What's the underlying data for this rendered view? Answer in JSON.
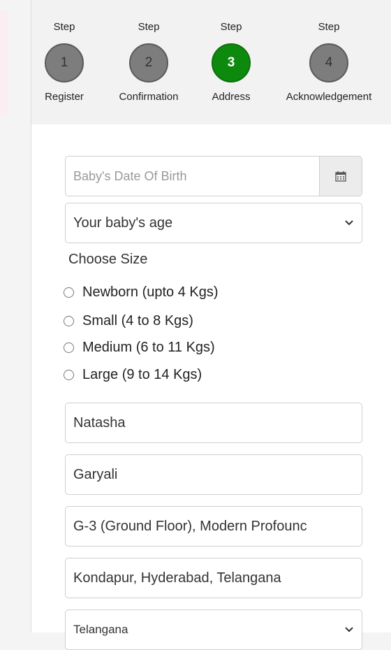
{
  "stepper": {
    "steps": [
      {
        "prefix": "Step",
        "number": "1",
        "label": "Register",
        "active": false
      },
      {
        "prefix": "Step",
        "number": "2",
        "label": "Confirmation",
        "active": false
      },
      {
        "prefix": "Step",
        "number": "3",
        "label": "Address",
        "active": true
      },
      {
        "prefix": "Step",
        "number": "4",
        "label": "Acknowledgement",
        "active": false
      }
    ]
  },
  "form": {
    "dob_placeholder": "Baby's Date Of Birth",
    "dob_icon": "calendar-icon",
    "age_select": "Your baby's age",
    "size_label": "Choose Size",
    "sizes": [
      "Newborn (upto 4 Kgs)",
      "Small (4 to 8 Kgs)",
      "Medium (6 to 11 Kgs)",
      "Large (9 to 14 Kgs)"
    ],
    "first_name": "Natasha",
    "last_name": "Garyali",
    "address_line1": "G-3 (Ground Floor), Modern Profounc",
    "address_line2": "Kondapur, Hyderabad, Telangana",
    "state_select": "Telangana"
  },
  "colors": {
    "active_step": "#0d8a0d",
    "inactive_step": "#7d7d7d"
  }
}
